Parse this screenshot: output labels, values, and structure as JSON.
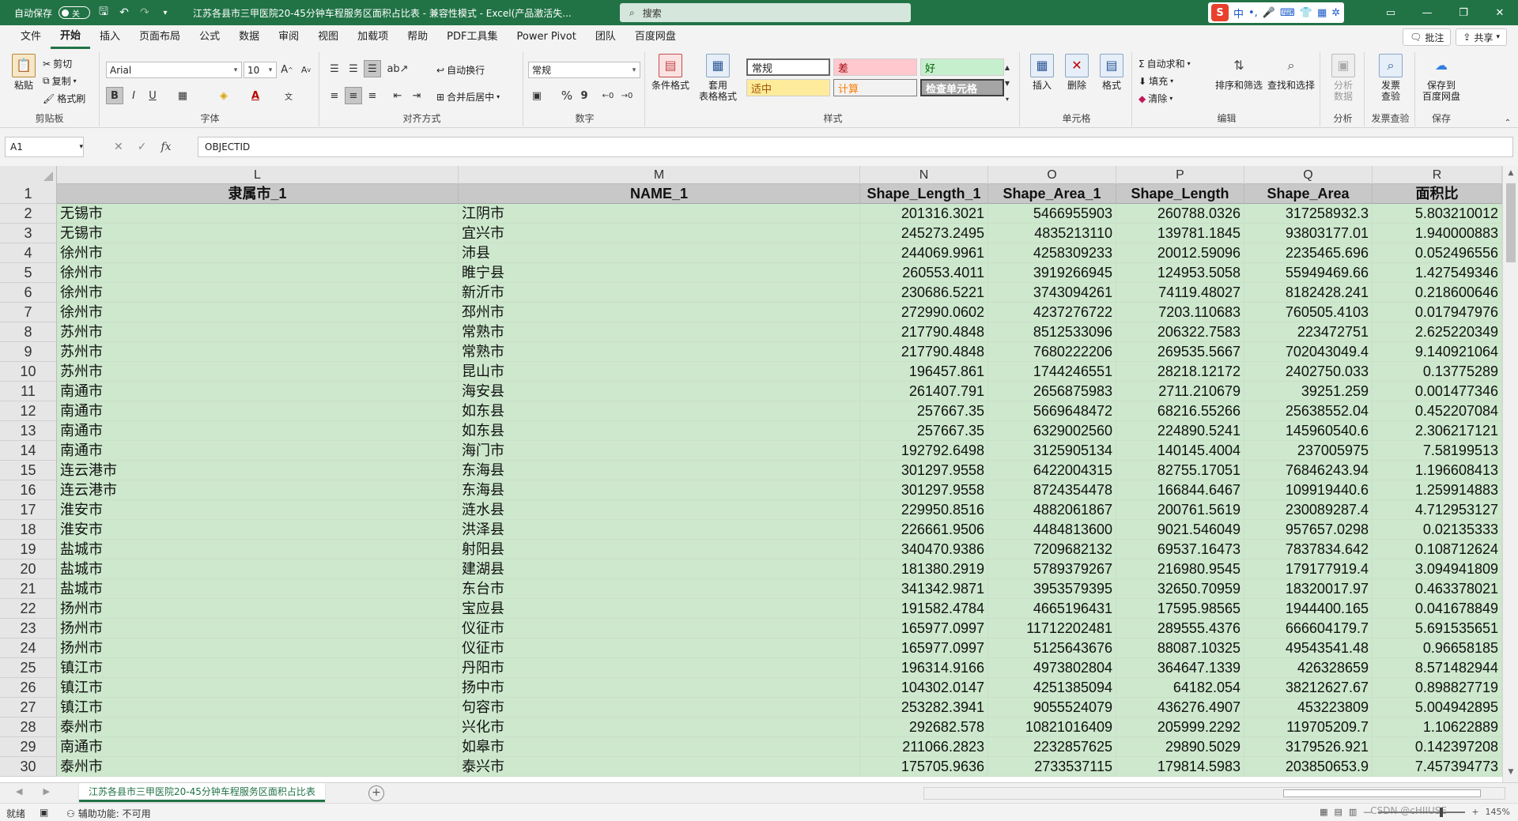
{
  "titlebar": {
    "autosave_label": "自动保存",
    "autosave_state": "关",
    "doc_title": "江苏各县市三甲医院20-45分钟车程服务区面积占比表 - 兼容性模式 - Excel(产品激活失...",
    "search_placeholder": "搜索",
    "ime_label": "中"
  },
  "menu": {
    "tabs": [
      "文件",
      "开始",
      "插入",
      "页面布局",
      "公式",
      "数据",
      "审阅",
      "视图",
      "加载项",
      "帮助",
      "PDF工具集",
      "Power Pivot",
      "团队",
      "百度网盘"
    ],
    "comment_label": "批注",
    "share_label": "共享"
  },
  "ribbon": {
    "clipboard": {
      "paste": "粘贴",
      "cut": "剪切",
      "copy": "复制",
      "format_painter": "格式刷",
      "label": "剪贴板"
    },
    "font": {
      "family": "Arial",
      "size": "10",
      "bold": "B",
      "italic": "I",
      "underline": "U",
      "label": "字体"
    },
    "alignment": {
      "wrap": "自动换行",
      "merge": "合并后居中",
      "label": "对齐方式"
    },
    "number": {
      "format": "常规",
      "percent": "%",
      "comma": "9",
      "label": "数字"
    },
    "styles": {
      "conditional": "条件格式",
      "table_format_1": "套用",
      "table_format_2": "表格格式",
      "cells": [
        "常规",
        "差",
        "好",
        "适中",
        "计算",
        "检查单元格"
      ],
      "label": "样式"
    },
    "cells": {
      "insert": "插入",
      "delete": "删除",
      "format": "格式",
      "label": "单元格"
    },
    "editing": {
      "autosum": "自动求和",
      "fill": "填充",
      "clear": "清除",
      "sort_filter": "排序和筛选",
      "find_select": "查找和选择",
      "label": "编辑"
    },
    "analysis": {
      "analyze_1": "分析",
      "analyze_2": "数据",
      "label": "分析"
    },
    "invoice": {
      "check_1": "发票",
      "check_2": "查验",
      "label": "发票查验"
    },
    "save": {
      "save_1": "保存到",
      "save_2": "百度网盘",
      "label": "保存"
    }
  },
  "formula_bar": {
    "name_box": "A1",
    "fx": "fx",
    "content": "OBJECTID"
  },
  "sheet": {
    "columns": [
      "L",
      "M",
      "N",
      "O",
      "P",
      "Q",
      "R"
    ],
    "header_row": [
      "隶属市_1",
      "NAME_1",
      "Shape_Length_1",
      "Shape_Area_1",
      "Shape_Length",
      "Shape_Area",
      "面积比"
    ],
    "rows": [
      [
        "2",
        "无锡市",
        "江阴市",
        "201316.3021",
        "5466955903",
        "260788.0326",
        "317258932.3",
        "5.803210012"
      ],
      [
        "3",
        "无锡市",
        "宜兴市",
        "245273.2495",
        "4835213110",
        "139781.1845",
        "93803177.01",
        "1.940000883"
      ],
      [
        "4",
        "徐州市",
        "沛县",
        "244069.9961",
        "4258309233",
        "20012.59096",
        "2235465.696",
        "0.052496556"
      ],
      [
        "5",
        "徐州市",
        "睢宁县",
        "260553.4011",
        "3919266945",
        "124953.5058",
        "55949469.66",
        "1.427549346"
      ],
      [
        "6",
        "徐州市",
        "新沂市",
        "230686.5221",
        "3743094261",
        "74119.48027",
        "8182428.241",
        "0.218600646"
      ],
      [
        "7",
        "徐州市",
        "邳州市",
        "272990.0602",
        "4237276722",
        "7203.110683",
        "760505.4103",
        "0.017947976"
      ],
      [
        "8",
        "苏州市",
        "常熟市",
        "217790.4848",
        "8512533096",
        "206322.7583",
        "223472751",
        "2.625220349"
      ],
      [
        "9",
        "苏州市",
        "常熟市",
        "217790.4848",
        "7680222206",
        "269535.5667",
        "702043049.4",
        "9.140921064"
      ],
      [
        "10",
        "苏州市",
        "昆山市",
        "196457.861",
        "1744246551",
        "28218.12172",
        "2402750.033",
        "0.13775289"
      ],
      [
        "11",
        "南通市",
        "海安县",
        "261407.791",
        "2656875983",
        "2711.210679",
        "39251.259",
        "0.001477346"
      ],
      [
        "12",
        "南通市",
        "如东县",
        "257667.35",
        "5669648472",
        "68216.55266",
        "25638552.04",
        "0.452207084"
      ],
      [
        "13",
        "南通市",
        "如东县",
        "257667.35",
        "6329002560",
        "224890.5241",
        "145960540.6",
        "2.306217121"
      ],
      [
        "14",
        "南通市",
        "海门市",
        "192792.6498",
        "3125905134",
        "140145.4004",
        "237005975",
        "7.58199513"
      ],
      [
        "15",
        "连云港市",
        "东海县",
        "301297.9558",
        "6422004315",
        "82755.17051",
        "76846243.94",
        "1.196608413"
      ],
      [
        "16",
        "连云港市",
        "东海县",
        "301297.9558",
        "8724354478",
        "166844.6467",
        "109919440.6",
        "1.259914883"
      ],
      [
        "17",
        "淮安市",
        "涟水县",
        "229950.8516",
        "4882061867",
        "200761.5619",
        "230089287.4",
        "4.712953127"
      ],
      [
        "18",
        "淮安市",
        "洪泽县",
        "226661.9506",
        "4484813600",
        "9021.546049",
        "957657.0298",
        "0.02135333"
      ],
      [
        "19",
        "盐城市",
        "射阳县",
        "340470.9386",
        "7209682132",
        "69537.16473",
        "7837834.642",
        "0.108712624"
      ],
      [
        "20",
        "盐城市",
        "建湖县",
        "181380.2919",
        "5789379267",
        "216980.9545",
        "179177919.4",
        "3.094941809"
      ],
      [
        "21",
        "盐城市",
        "东台市",
        "341342.9871",
        "3953579395",
        "32650.70959",
        "18320017.97",
        "0.463378021"
      ],
      [
        "22",
        "扬州市",
        "宝应县",
        "191582.4784",
        "4665196431",
        "17595.98565",
        "1944400.165",
        "0.041678849"
      ],
      [
        "23",
        "扬州市",
        "仪征市",
        "165977.0997",
        "11712202481",
        "289555.4376",
        "666604179.7",
        "5.691535651"
      ],
      [
        "24",
        "扬州市",
        "仪征市",
        "165977.0997",
        "5125643676",
        "88087.10325",
        "49543541.48",
        "0.96658185"
      ],
      [
        "25",
        "镇江市",
        "丹阳市",
        "196314.9166",
        "4973802804",
        "364647.1339",
        "426328659",
        "8.571482944"
      ],
      [
        "26",
        "镇江市",
        "扬中市",
        "104302.0147",
        "4251385094",
        "64182.054",
        "38212627.67",
        "0.898827719"
      ],
      [
        "27",
        "镇江市",
        "句容市",
        "253282.3941",
        "9055524079",
        "436276.4907",
        "453223809",
        "5.004942895"
      ],
      [
        "28",
        "泰州市",
        "兴化市",
        "292682.578",
        "10821016409",
        "205999.2292",
        "119705209.7",
        "1.10622889"
      ],
      [
        "29",
        "南通市",
        "如皋市",
        "211066.2823",
        "2232857625",
        "29890.5029",
        "3179526.921",
        "0.142397208"
      ],
      [
        "30",
        "泰州市",
        "泰兴市",
        "175705.9636",
        "2733537115",
        "179814.5983",
        "203850653.9",
        "7.457394773"
      ]
    ],
    "row_header_1": "1"
  },
  "sheet_tab": {
    "name": "江苏各县市三甲医院20-45分钟车程服务区面积占比表"
  },
  "status": {
    "ready": "就绪",
    "accessibility": "辅助功能: 不可用",
    "zoom": "145%",
    "watermark": "CSDN @cHIIUSE"
  },
  "colors": {
    "brand": "#217346",
    "cell_fill": "#cde8cd",
    "header_fill": "#c8c8c8"
  }
}
